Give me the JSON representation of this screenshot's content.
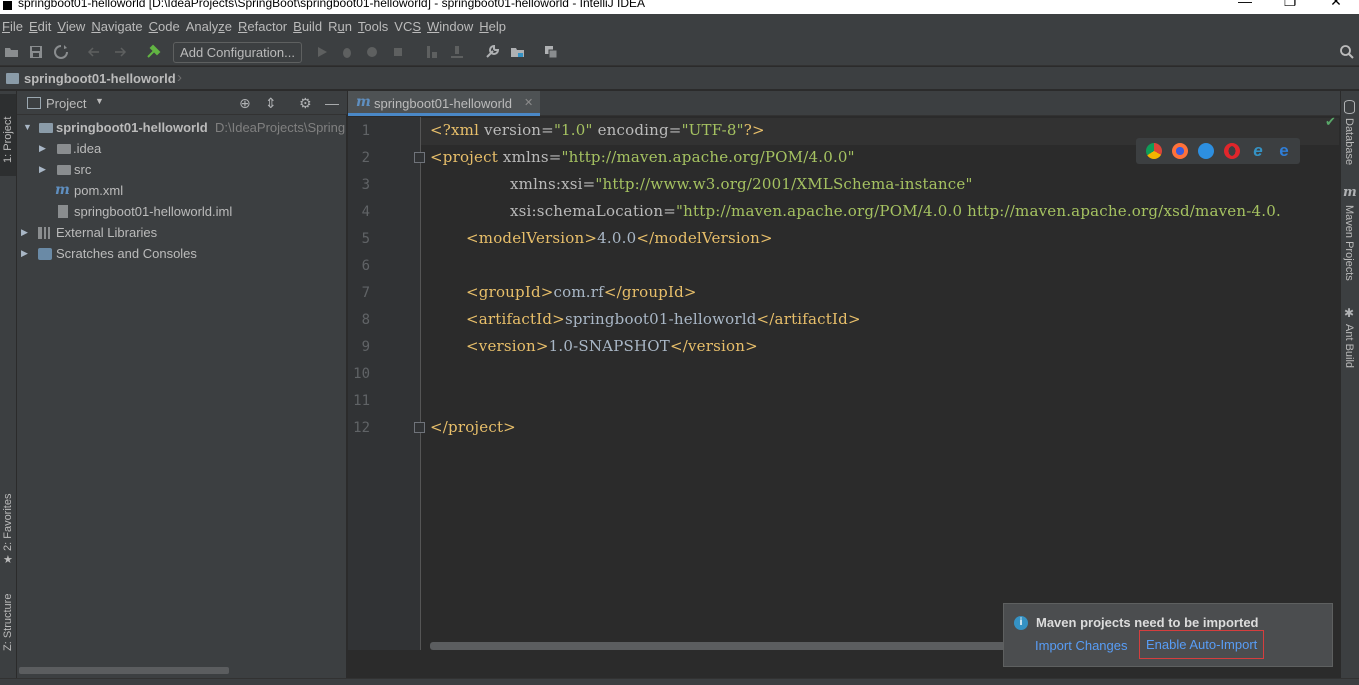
{
  "window": {
    "title": "springboot01-helloworld [D:\\IdeaProjects\\SpringBoot\\springboot01-helloworld] - springboot01-helloworld - IntelliJ IDEA",
    "minimize": "—",
    "maximize": "❐",
    "close": "✕"
  },
  "menu": [
    {
      "u": "F",
      "rest": "ile"
    },
    {
      "u": "E",
      "rest": "dit"
    },
    {
      "u": "V",
      "rest": "iew"
    },
    {
      "u": "N",
      "rest": "avigate"
    },
    {
      "u": "C",
      "rest": "ode"
    },
    {
      "u": "",
      "rest": "Analy",
      "u2": "z",
      "rest2": "e"
    },
    {
      "u": "R",
      "rest": "efactor"
    },
    {
      "u": "B",
      "rest": "uild"
    },
    {
      "u": "",
      "rest": "R",
      "u2": "u",
      "rest2": "n"
    },
    {
      "u": "T",
      "rest": "ools"
    },
    {
      "u": "",
      "rest": "VC",
      "u2": "S",
      "rest2": ""
    },
    {
      "u": "W",
      "rest": "indow"
    },
    {
      "u": "H",
      "rest": "elp"
    }
  ],
  "toolbar": {
    "add_configuration": "Add Configuration..."
  },
  "breadcrumb": {
    "project": "springboot01-helloworld"
  },
  "left_stripe": {
    "project_tab": "1: Project",
    "favorites_tab": "2: Favorites",
    "structure_tab": "Z: Structure"
  },
  "project_panel": {
    "title": "Project",
    "tree": {
      "root_name": "springboot01-helloworld",
      "root_path": "D:\\IdeaProjects\\Spring",
      "idea": ".idea",
      "src": "src",
      "pom": "pom.xml",
      "iml": "springboot01-helloworld.iml",
      "external_libraries": "External Libraries",
      "scratches": "Scratches and Consoles"
    }
  },
  "editor": {
    "tab_label": "springboot01-helloworld",
    "line_numbers": [
      "1",
      "2",
      "3",
      "4",
      "5",
      "6",
      "7",
      "8",
      "9",
      "10",
      "11",
      "12"
    ],
    "lines": {
      "l1": {
        "a": "<?xml ",
        "b": "version=",
        "c": "\"1.0\"",
        "d": " encoding=",
        "e": "\"UTF-8\"",
        "f": "?>"
      },
      "l2": {
        "a": "<project ",
        "b": "xmlns=",
        "c": "\"http://maven.apache.org/POM/4.0.0\""
      },
      "l3": {
        "a": "xmlns:xsi=",
        "c": "\"http://www.w3.org/2001/XMLSchema-instance\""
      },
      "l4": {
        "a": "xsi:schemaLocation=",
        "c": "\"http://maven.apache.org/POM/4.0.0 http://maven.apache.org/xsd/maven-4.0."
      },
      "l5": {
        "open": "<modelVersion>",
        "text": "4.0.0",
        "close": "</modelVersion>"
      },
      "l7": {
        "open": "<groupId>",
        "text": "com.rf",
        "close": "</groupId>"
      },
      "l8": {
        "open": "<artifactId>",
        "text": "springboot01-helloworld",
        "close": "</artifactId>"
      },
      "l9": {
        "open": "<version>",
        "text": "1.0-SNAPSHOT",
        "close": "</version>"
      },
      "l12": {
        "close": "</project>"
      }
    }
  },
  "right_stripe": {
    "database": "Database",
    "maven": "Maven Projects",
    "ant": "Ant Build"
  },
  "notification": {
    "title": "Maven projects need to be imported",
    "import_changes": "Import Changes",
    "enable_auto_import": "Enable Auto-Import"
  },
  "colors": {
    "background": "#2b2b2b",
    "panel": "#3c3f41",
    "tag": "#e8bf6a",
    "string": "#a5c261",
    "link": "#589df6",
    "accent": "#4a88c7"
  }
}
